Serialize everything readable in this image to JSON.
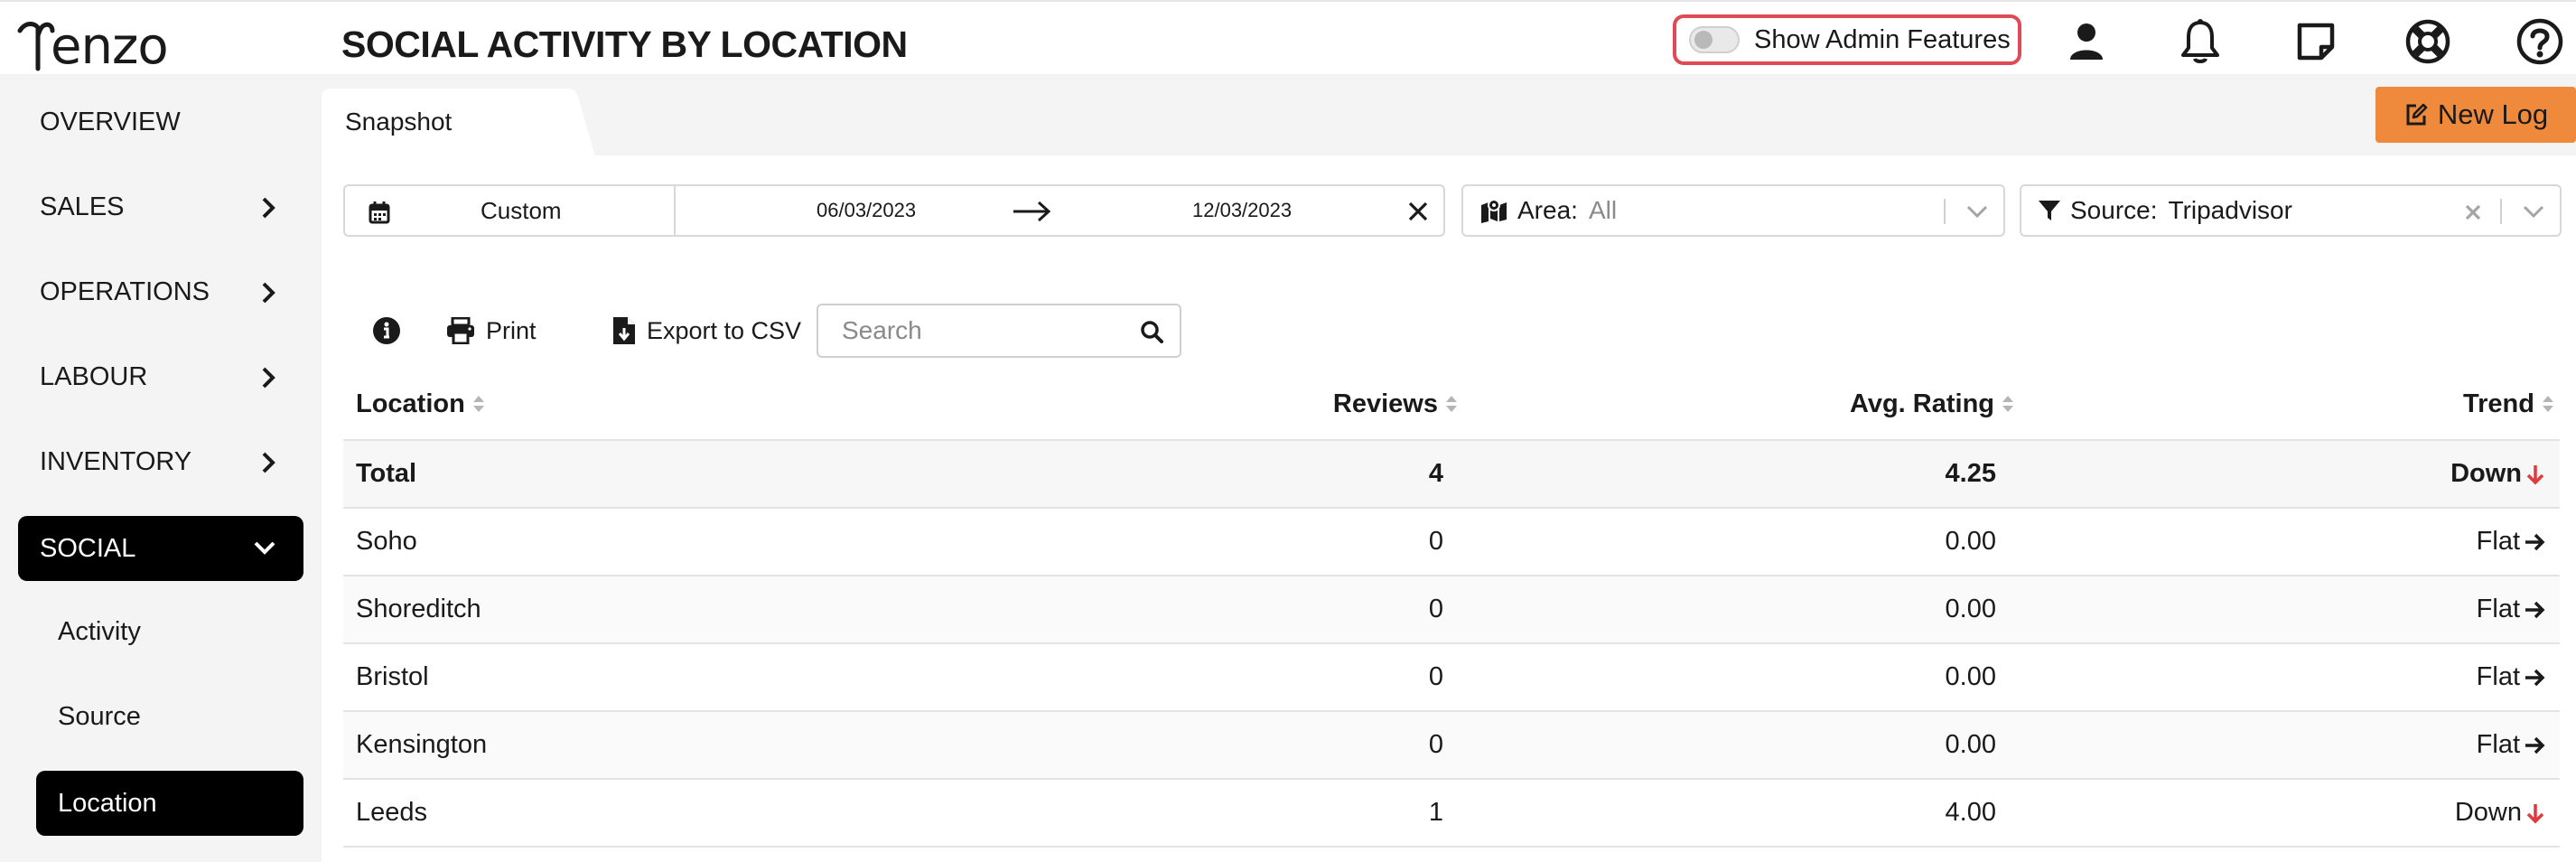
{
  "app": {
    "logo_text": "enzo",
    "logo_full_name": "Tenzo",
    "page_title": "SOCIAL ACTIVITY BY LOCATION"
  },
  "header": {
    "admin_toggle_label": "Show Admin Features",
    "admin_toggle_on": false,
    "icons": [
      "user-icon",
      "bell-icon",
      "note-icon",
      "support-icon",
      "help-icon"
    ]
  },
  "sidebar": {
    "items": [
      {
        "label": "OVERVIEW",
        "has_chevron": false
      },
      {
        "label": "SALES",
        "has_chevron": true
      },
      {
        "label": "OPERATIONS",
        "has_chevron": true
      },
      {
        "label": "LABOUR",
        "has_chevron": true
      },
      {
        "label": "INVENTORY",
        "has_chevron": true
      },
      {
        "label": "SOCIAL",
        "has_chevron": true,
        "expanded": true,
        "active": true
      }
    ],
    "sub_items": [
      {
        "label": "Activity"
      },
      {
        "label": "Source"
      },
      {
        "label": "Location",
        "active": true
      }
    ]
  },
  "tabs": {
    "snapshot": "Snapshot"
  },
  "actions": {
    "new_log": "New Log"
  },
  "filters": {
    "date_mode": "Custom",
    "start_date": "06/03/2023",
    "end_date": "12/03/2023",
    "area_label": "Area:",
    "area_value": "All",
    "source_label": "Source:",
    "source_value": "Tripadvisor"
  },
  "toolbar": {
    "print": "Print",
    "export": "Export to CSV",
    "search_placeholder": "Search"
  },
  "table": {
    "headers": {
      "location": "Location",
      "reviews": "Reviews",
      "avg_rating": "Avg. Rating",
      "trend": "Trend"
    },
    "rows": [
      {
        "location": "Total",
        "reviews": "4",
        "avg_rating": "4.25",
        "trend": "Down",
        "trend_dir": "down"
      },
      {
        "location": "Soho",
        "reviews": "0",
        "avg_rating": "0.00",
        "trend": "Flat",
        "trend_dir": "flat"
      },
      {
        "location": "Shoreditch",
        "reviews": "0",
        "avg_rating": "0.00",
        "trend": "Flat",
        "trend_dir": "flat"
      },
      {
        "location": "Bristol",
        "reviews": "0",
        "avg_rating": "0.00",
        "trend": "Flat",
        "trend_dir": "flat"
      },
      {
        "location": "Kensington",
        "reviews": "0",
        "avg_rating": "0.00",
        "trend": "Flat",
        "trend_dir": "flat"
      },
      {
        "location": "Leeds",
        "reviews": "1",
        "avg_rating": "4.00",
        "trend": "Down",
        "trend_dir": "down"
      }
    ]
  },
  "colors": {
    "accent_orange": "#ef8a3c",
    "toggle_border": "#e04a56",
    "trend_down": "#e0393e",
    "active_nav": "#000000"
  }
}
